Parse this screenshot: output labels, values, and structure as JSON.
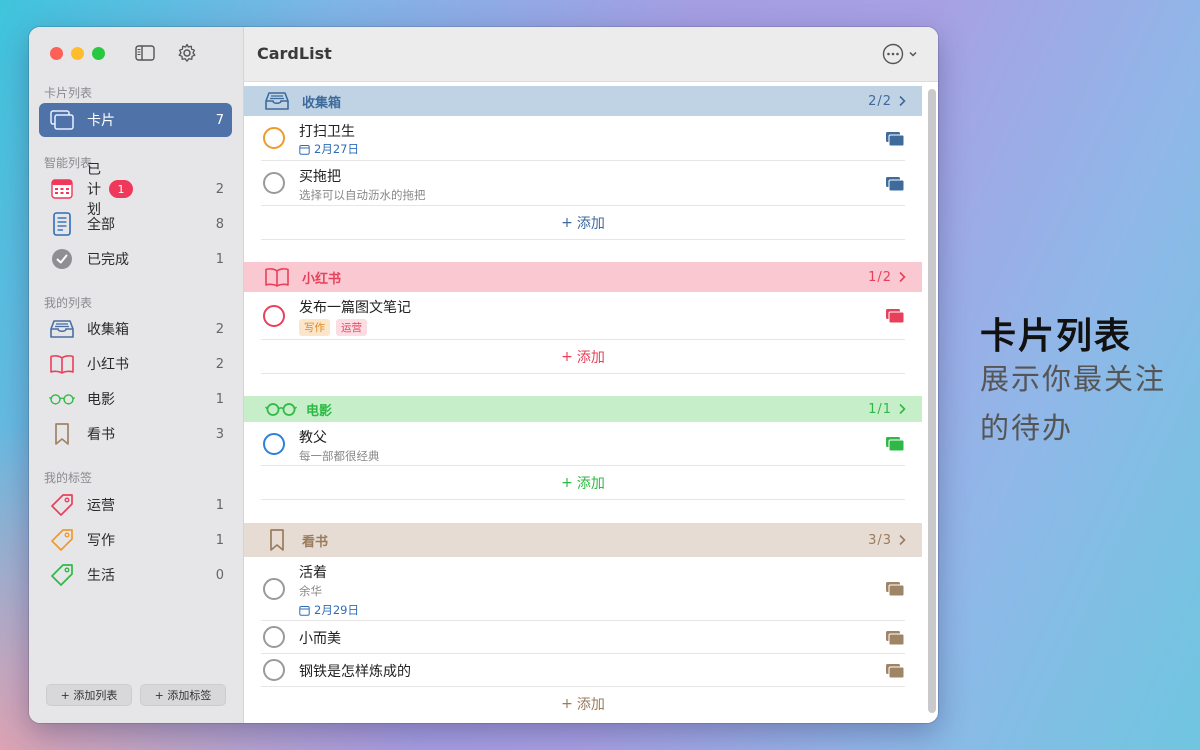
{
  "app": {
    "title": "CardList"
  },
  "sidebar": {
    "sections": {
      "cards": "卡片列表",
      "smart": "智能列表",
      "mine": "我的列表",
      "tags": "我的标签"
    },
    "card_item": {
      "label": "卡片",
      "count": "7",
      "icon": "cards-icon"
    },
    "smart_items": [
      {
        "label": "已计划",
        "count": "2",
        "badge": "1",
        "icon": "calendar-icon"
      },
      {
        "label": "全部",
        "count": "8",
        "icon": "list-icon"
      },
      {
        "label": "已完成",
        "count": "1",
        "icon": "checkmark-icon"
      }
    ],
    "my_lists": [
      {
        "label": "收集箱",
        "count": "2",
        "icon": "inbox-icon",
        "color": "#4a6fa0"
      },
      {
        "label": "小红书",
        "count": "2",
        "icon": "book-icon",
        "color": "#e8405a"
      },
      {
        "label": "电影",
        "count": "1",
        "icon": "glasses-icon",
        "color": "#2fb845"
      },
      {
        "label": "看书",
        "count": "3",
        "icon": "bookmark-icon",
        "color": "#a08466"
      }
    ],
    "tags": [
      {
        "label": "运营",
        "count": "1",
        "icon": "tag-icon",
        "color": "#e8405a"
      },
      {
        "label": "写作",
        "count": "1",
        "icon": "tag-icon",
        "color": "#ef9a2c"
      },
      {
        "label": "生活",
        "count": "0",
        "icon": "tag-icon",
        "color": "#2fb845"
      }
    ],
    "add_list": "+ 添加列表",
    "add_tag": "+ 添加标签"
  },
  "main": {
    "add_label": "添加",
    "sections": [
      {
        "title": "收集箱",
        "count": "2/2",
        "icon": "inbox-icon",
        "color": "#3f6a9c",
        "bg": "#bfd3e4",
        "items": [
          {
            "title": "打扫卫生",
            "date": "2月27日",
            "circle": "#ef9a2c"
          },
          {
            "title": "买拖把",
            "subtitle": "选择可以自动沥水的拖把",
            "circle": "#9a9a9a"
          }
        ]
      },
      {
        "title": "小红书",
        "count": "1/2",
        "icon": "book-icon",
        "color": "#e8405a",
        "bg": "#f9c8d1",
        "items": [
          {
            "title": "发布一篇图文笔记",
            "tags": [
              "写作",
              "运营"
            ],
            "circle": "#e8405a"
          }
        ]
      },
      {
        "title": "电影",
        "count": "1/1",
        "icon": "glasses-icon",
        "color": "#2fb845",
        "bg": "#c6eec8",
        "items": [
          {
            "title": "教父",
            "subtitle": "每一部都很经典",
            "circle": "#2f7fdc"
          }
        ]
      },
      {
        "title": "看书",
        "count": "3/3",
        "icon": "bookmark-icon",
        "color": "#9a7c5c",
        "bg": "#e6dcd3",
        "items": [
          {
            "title": "活着",
            "subtitle": "余华",
            "date": "2月29日",
            "circle": "#9a9a9a"
          },
          {
            "title": "小而美",
            "circle": "#9a9a9a"
          },
          {
            "title": "钢铁是怎样炼成的",
            "circle": "#9a9a9a"
          }
        ]
      }
    ]
  },
  "promo": {
    "title": "卡片列表",
    "subtitle": "展示你最关注的待办"
  }
}
